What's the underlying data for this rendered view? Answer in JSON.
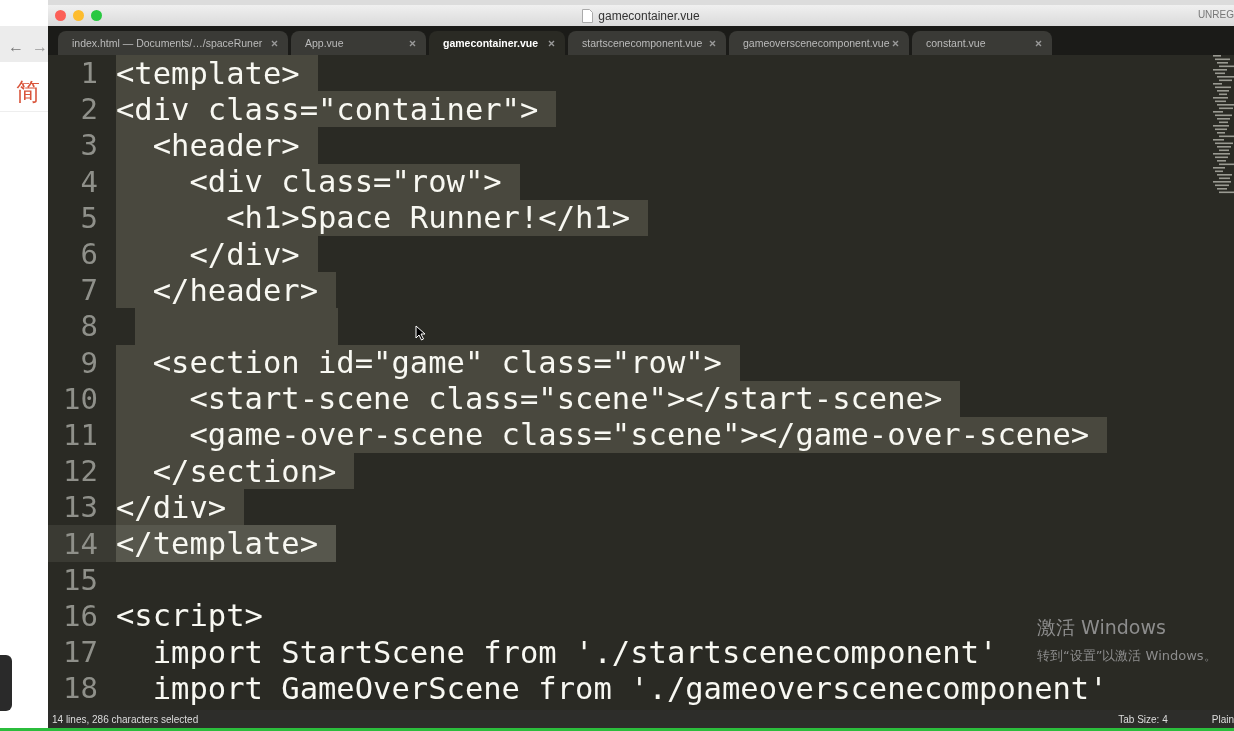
{
  "background_browser": {
    "back": "←",
    "forward": "→",
    "heading": "简"
  },
  "window": {
    "title": "gamecontainer.vue",
    "license": "UNREG"
  },
  "tabs": [
    {
      "label": "index.html — Documents/…/spaceRuner",
      "selected": false
    },
    {
      "label": "App.vue",
      "selected": false
    },
    {
      "label": "gamecontainer.vue",
      "selected": true
    },
    {
      "label": "startscenecomponent.vue",
      "selected": false
    },
    {
      "label": "gameoverscenecomponent.vue",
      "selected": false
    },
    {
      "label": "constant.vue",
      "selected": false
    }
  ],
  "lines": [
    {
      "number": "1",
      "text": "<template>",
      "selected": true,
      "current": false
    },
    {
      "number": "2",
      "text": "<div class=\"container\">",
      "selected": true,
      "current": false
    },
    {
      "number": "3",
      "text": "  <header>",
      "selected": true,
      "current": false
    },
    {
      "number": "4",
      "text": "    <div class=\"row\">",
      "selected": true,
      "current": false
    },
    {
      "number": "5",
      "text": "      <h1>Space Runner!</h1>",
      "selected": true,
      "current": false
    },
    {
      "number": "6",
      "text": "    </div>",
      "selected": true,
      "current": false
    },
    {
      "number": "7",
      "text": "  </header>",
      "selected": true,
      "current": false
    },
    {
      "number": "8",
      "selected": true,
      "current": false
    },
    {
      "number": "9",
      "text": "  <section id=\"game\" class=\"row\">",
      "selected": true,
      "current": false
    },
    {
      "number": "10",
      "text": "    <start-scene class=\"scene\"></start-scene>",
      "selected": true,
      "current": false
    },
    {
      "number": "11",
      "text": "    <game-over-scene class=\"scene\"></game-over-scene>",
      "selected": true,
      "current": false
    },
    {
      "number": "12",
      "text": "  </section>",
      "selected": true,
      "current": false
    },
    {
      "number": "13",
      "text": "</div>",
      "selected": true,
      "current": false
    },
    {
      "number": "14",
      "text": "</template>",
      "selected": true,
      "current": true
    },
    {
      "number": "15",
      "selected": false,
      "current": false
    },
    {
      "number": "16",
      "text": "<script>",
      "selected": false,
      "current": false
    },
    {
      "number": "17",
      "text": "  import StartScene from './startscenecomponent'",
      "selected": false,
      "current": false
    },
    {
      "number": "18",
      "text": "  import GameOverScene from './gameoverscenecomponent'",
      "selected": false,
      "current": false
    }
  ],
  "activation": {
    "title": "激活 Windows",
    "hint": "转到“设置”以激活 Windows。"
  },
  "status_bar": {
    "selection": "14 lines, 286 characters selected",
    "tab_size": "Tab Size: 4",
    "syntax": "Plain"
  }
}
